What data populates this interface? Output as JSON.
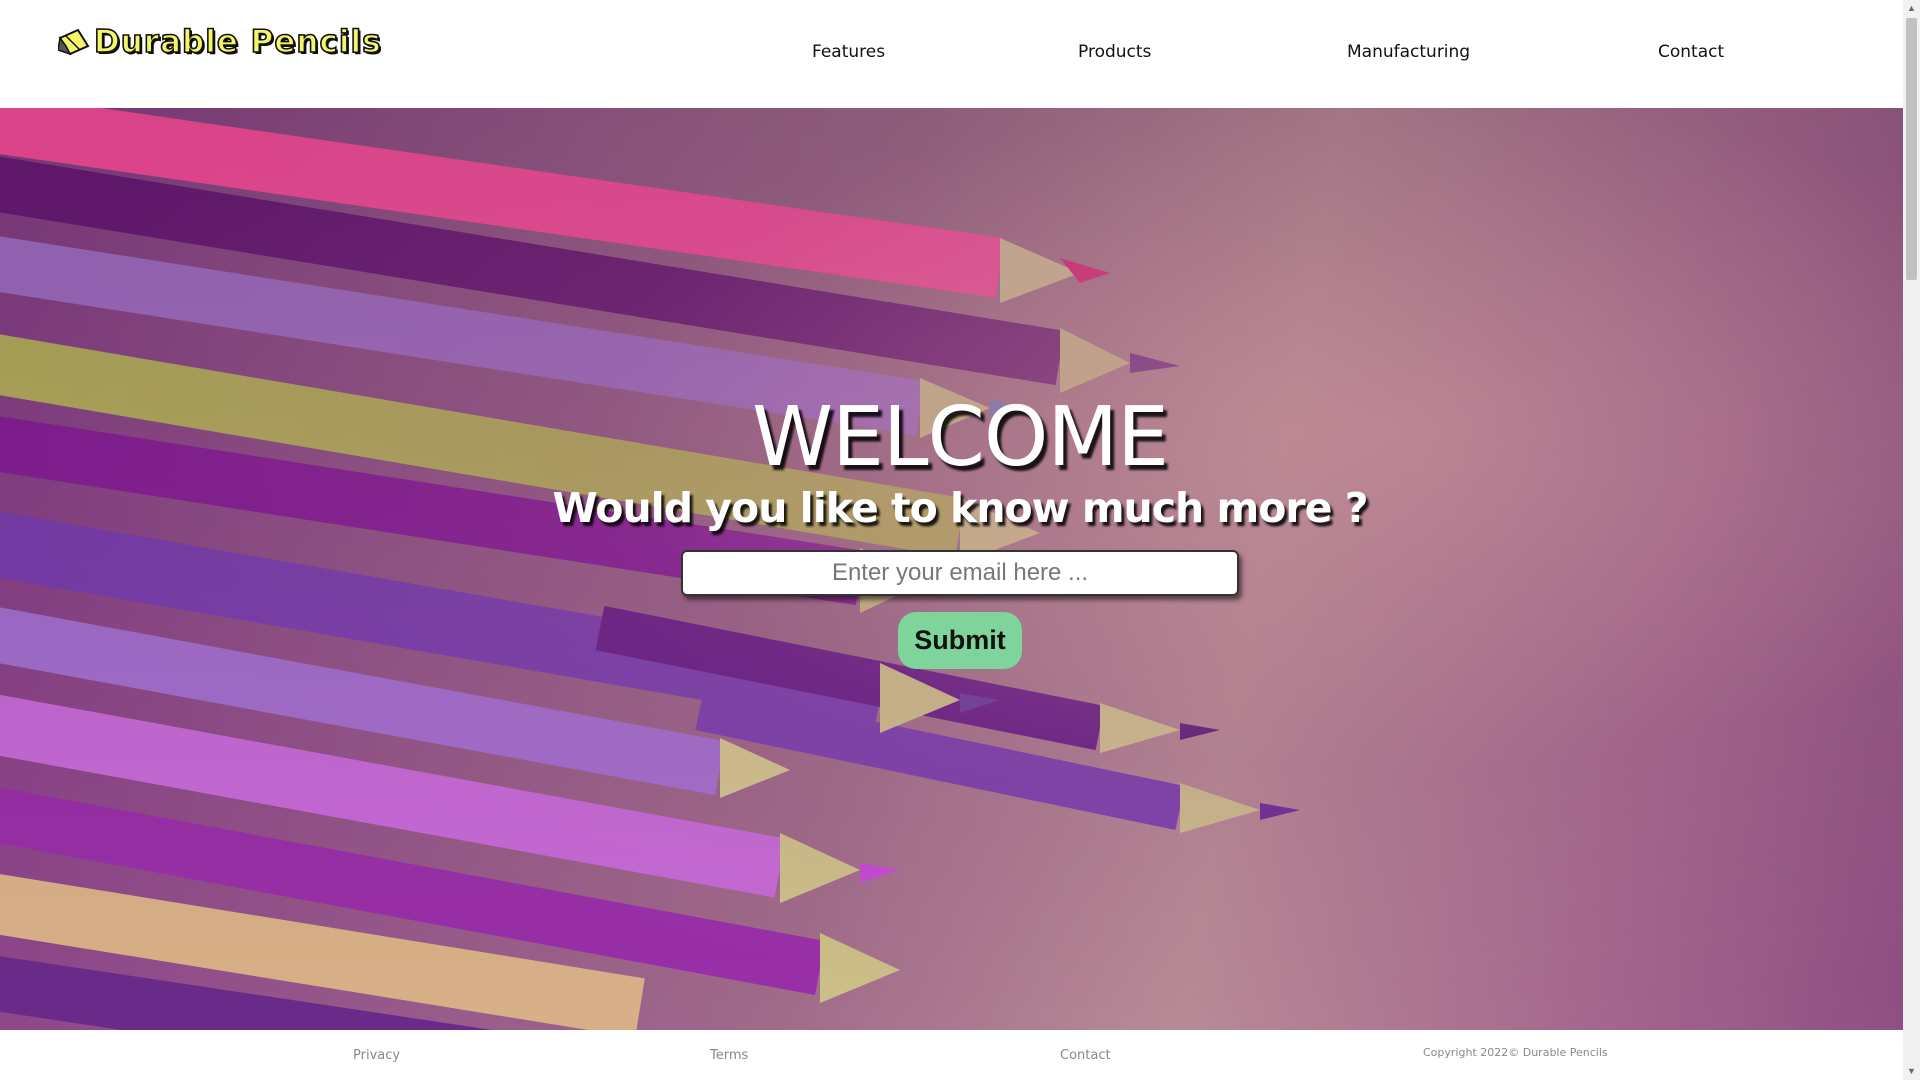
{
  "header": {
    "logo_text": "Durable Pencils",
    "logo_icon": "pencil-icon",
    "nav": [
      {
        "label": "Features"
      },
      {
        "label": "Products"
      },
      {
        "label": "Manufacturing"
      },
      {
        "label": "Contact"
      }
    ]
  },
  "hero": {
    "title": "WELCOME",
    "subtitle": "Would you like to know much more ?",
    "email_placeholder": "Enter your email here ...",
    "email_value": "",
    "submit_label": "Submit"
  },
  "footer": {
    "links": [
      {
        "label": "Privacy"
      },
      {
        "label": "Terms"
      },
      {
        "label": "Contact"
      }
    ],
    "copyright": "Copyright 2022©  Durable Pencils"
  },
  "colors": {
    "logo_yellow": "#f5f56a",
    "submit_green": "#7fd49b",
    "hero_purple": "#8a3f8a"
  }
}
